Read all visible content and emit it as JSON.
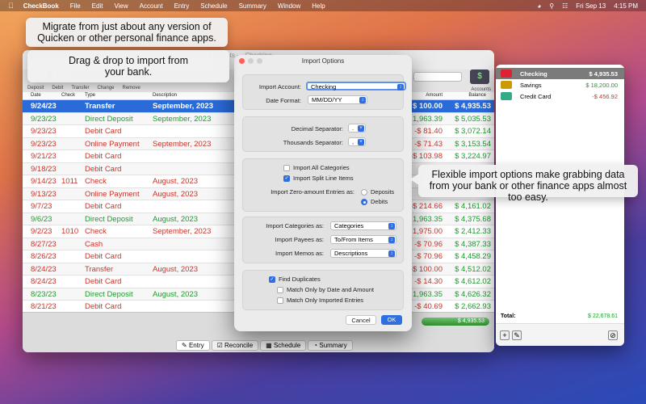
{
  "menubar": {
    "app": "CheckBook",
    "items": [
      "File",
      "Edit",
      "View",
      "Account",
      "Entry",
      "Schedule",
      "Summary",
      "Window",
      "Help"
    ],
    "date": "Fri Sep 13",
    "time": "4:15 PM"
  },
  "tooltips": {
    "migrate": "Migrate from just about any version of Quicken or other personal finance apps.",
    "dragdrop": "Drag & drop to import from your bank.",
    "flexible": "Flexible import options make grabbing data from your bank or other finance apps almost too easy."
  },
  "mainwin": {
    "title": "Accounts — Checking",
    "toolbar_labels": [
      "Deposit",
      "Debit",
      "Transfer",
      "Change",
      "Remove"
    ],
    "accounts_label": "Accounts",
    "columns": {
      "date": "Date",
      "check": "Check",
      "type": "Type",
      "description": "Description",
      "amount": "Amount",
      "balance": "Balance"
    },
    "rows": [
      {
        "date": "9/24/23",
        "check": "",
        "type": "Transfer",
        "desc": "September, 2023",
        "amount": "$ 100.00",
        "balance": "$ 4,935.53",
        "color": "blue",
        "selected": true
      },
      {
        "date": "9/23/23",
        "check": "",
        "type": "Direct Deposit",
        "desc": "September, 2023",
        "amount": "$ 1,963.39",
        "balance": "$ 5,035.53",
        "color": "green"
      },
      {
        "date": "9/23/23",
        "check": "",
        "type": "Debit Card",
        "desc": "",
        "amount": "-$ 81.40",
        "balance": "$ 3,072.14",
        "color": "red"
      },
      {
        "date": "9/23/23",
        "check": "",
        "type": "Online Payment",
        "desc": "September, 2023",
        "amount": "-$ 71.43",
        "balance": "$ 3,153.54",
        "color": "red"
      },
      {
        "date": "9/21/23",
        "check": "",
        "type": "Debit Card",
        "desc": "",
        "amount": "-$ 103.98",
        "balance": "$ 3,224.97",
        "color": "red"
      },
      {
        "date": "9/18/23",
        "check": "",
        "type": "Debit Card",
        "desc": "",
        "amount": "",
        "balance": "",
        "color": "red"
      },
      {
        "date": "9/14/23",
        "check": "1011",
        "type": "Check",
        "desc": "August, 2023",
        "amount": "",
        "balance": "",
        "color": "red"
      },
      {
        "date": "9/13/23",
        "check": "",
        "type": "Online Payment",
        "desc": "August, 2023",
        "amount": "",
        "balance": "",
        "color": "red"
      },
      {
        "date": "9/7/23",
        "check": "",
        "type": "Debit Card",
        "desc": "",
        "amount": "-$ 214.66",
        "balance": "$ 4,161.02",
        "color": "red"
      },
      {
        "date": "9/6/23",
        "check": "",
        "type": "Direct Deposit",
        "desc": "August, 2023",
        "amount": "$ 1,963.35",
        "balance": "$ 4,375.68",
        "color": "green"
      },
      {
        "date": "9/2/23",
        "check": "1010",
        "type": "Check",
        "desc": "September, 2023",
        "amount": "-$ 1,975.00",
        "balance": "$ 2,412.33",
        "color": "red"
      },
      {
        "date": "8/27/23",
        "check": "",
        "type": "Cash",
        "desc": "",
        "amount": "-$ 70.96",
        "balance": "$ 4,387.33",
        "color": "red"
      },
      {
        "date": "8/26/23",
        "check": "",
        "type": "Debit Card",
        "desc": "",
        "amount": "-$ 70.96",
        "balance": "$ 4,458.29",
        "color": "red"
      },
      {
        "date": "8/24/23",
        "check": "",
        "type": "Transfer",
        "desc": "August, 2023",
        "amount": "-$ 100.00",
        "balance": "$ 4,512.02",
        "color": "red"
      },
      {
        "date": "8/24/23",
        "check": "",
        "type": "Debit Card",
        "desc": "",
        "amount": "-$ 14.30",
        "balance": "$ 4,612.02",
        "color": "red"
      },
      {
        "date": "8/23/23",
        "check": "",
        "type": "Direct Deposit",
        "desc": "August, 2023",
        "amount": "$ 1,963.35",
        "balance": "$ 4,626.32",
        "color": "green"
      },
      {
        "date": "8/21/23",
        "check": "",
        "type": "Debit Card",
        "desc": "",
        "amount": "-$ 40.69",
        "balance": "$ 2,662.93",
        "color": "red"
      }
    ],
    "total_balance": "$ 4,935.53",
    "modes": [
      "Entry",
      "Reconcile",
      "Schedule",
      "Summary"
    ]
  },
  "accounts": {
    "items": [
      {
        "name": "Checking",
        "balance": "$ 4,935.53",
        "selected": true,
        "color": "#d23"
      },
      {
        "name": "Savings",
        "balance": "$ 18,200.00",
        "color": "#c90"
      },
      {
        "name": "Credit Card",
        "balance": "-$ 456.92",
        "color": "#3a8"
      }
    ],
    "total_label": "Total:",
    "total_value": "$ 22,678.61"
  },
  "dialog": {
    "title": "Import Options",
    "import_account_label": "Import Account:",
    "import_account_value": "Checking",
    "date_format_label": "Date Format:",
    "date_format_value": "MM/DD/YY",
    "decimal_label": "Decimal Separator:",
    "decimal_value": ".",
    "thousands_label": "Thousands Separator:",
    "thousands_value": ",",
    "import_all_categories": "Import All Categories",
    "import_split": "Import Split Line Items",
    "zero_amount_label": "Import Zero-amount Entries as:",
    "deposits": "Deposits",
    "debits": "Debits",
    "categories_label": "Import Categories as:",
    "categories_value": "Categories",
    "payees_label": "Import Payees as:",
    "payees_value": "To/From Items",
    "memos_label": "Import Memos as:",
    "memos_value": "Descriptions",
    "find_duplicates": "Find Duplicates",
    "match_date_amount": "Match Only by Date and Amount",
    "match_imported": "Match Only Imported Entries",
    "cancel": "Cancel",
    "ok": "OK"
  }
}
